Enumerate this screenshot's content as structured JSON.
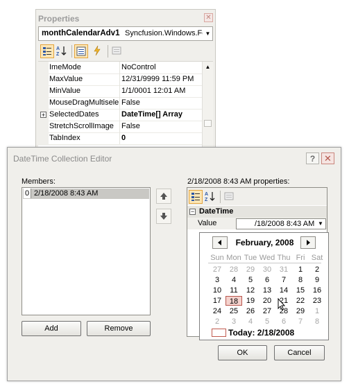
{
  "properties_window": {
    "title": "Properties",
    "object_name": "monthCalendarAdv1",
    "object_type": "Syncfusion.Windows.Fo",
    "rows": [
      {
        "name": "ImeMode",
        "value": "NoControl",
        "bold": false,
        "expandable": false
      },
      {
        "name": "MaxValue",
        "value": "12/31/9999 11:59 PM",
        "bold": false,
        "expandable": false
      },
      {
        "name": "MinValue",
        "value": "1/1/0001 12:01 AM",
        "bold": false,
        "expandable": false
      },
      {
        "name": "MouseDragMultiselect",
        "value": "False",
        "bold": false,
        "expandable": false
      },
      {
        "name": "SelectedDates",
        "value": "DateTime[] Array",
        "bold": true,
        "expandable": true
      },
      {
        "name": "StretchScrollImage",
        "value": "False",
        "bold": false,
        "expandable": false
      },
      {
        "name": "TabIndex",
        "value": "0",
        "bold": true,
        "expandable": false
      }
    ]
  },
  "dialog": {
    "title": "DateTime Collection Editor",
    "members_label": "Members:",
    "members": [
      {
        "index": "0",
        "value": "2/18/2008 8:43 AM"
      }
    ],
    "add_label": "Add",
    "remove_label": "Remove",
    "properties_label": "2/18/2008 8:43 AM properties:",
    "category": "DateTime",
    "value_name": "Value",
    "value": "/18/2008 8:43 AM",
    "ok_label": "OK",
    "cancel_label": "Cancel"
  },
  "calendar": {
    "month_title": "February, 2008",
    "day_names": [
      "Sun",
      "Mon",
      "Tue",
      "Wed",
      "Thu",
      "Fri",
      "Sat"
    ],
    "weeks": [
      [
        "27",
        "28",
        "29",
        "30",
        "31",
        "1",
        "2"
      ],
      [
        "3",
        "4",
        "5",
        "6",
        "7",
        "8",
        "9"
      ],
      [
        "10",
        "11",
        "12",
        "13",
        "14",
        "15",
        "16"
      ],
      [
        "17",
        "18",
        "19",
        "20",
        "21",
        "22",
        "23"
      ],
      [
        "24",
        "25",
        "26",
        "27",
        "28",
        "29",
        "1"
      ],
      [
        "2",
        "3",
        "4",
        "5",
        "6",
        "7",
        "8"
      ]
    ],
    "selected_day": "18",
    "today_label": "Today: 2/18/2008"
  },
  "colors": {
    "selection_border": "#b8574e",
    "toolbar_active": "#fbe6b6"
  }
}
